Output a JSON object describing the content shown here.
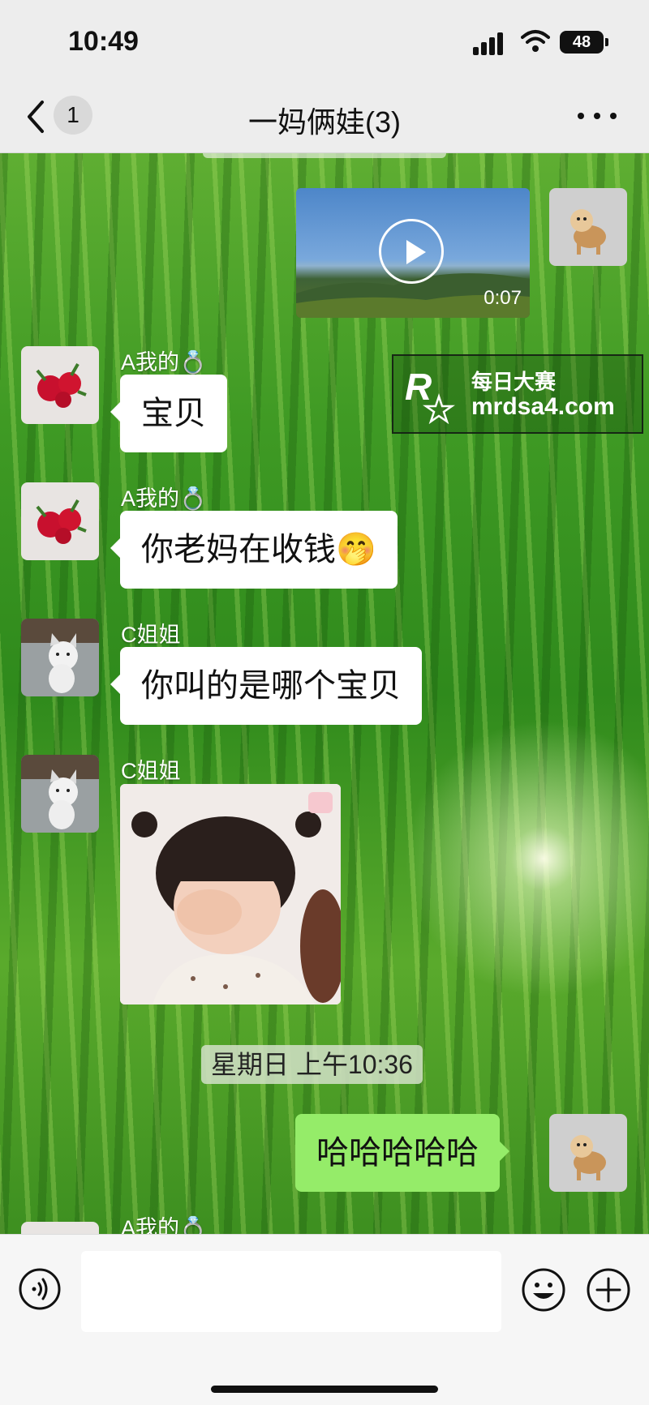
{
  "status_bar": {
    "time": "10:49",
    "battery": "48"
  },
  "nav": {
    "unread_count": "1",
    "title": "一妈俩娃(3)"
  },
  "messages": [
    {
      "type": "video",
      "sender": "me",
      "duration": "0:07"
    },
    {
      "type": "text",
      "sender_name": "A我的💍",
      "text": "宝贝"
    },
    {
      "type": "text",
      "sender_name": "A我的💍",
      "text": "你老妈在收钱🤭"
    },
    {
      "type": "text",
      "sender_name": "C姐姐",
      "text": "你叫的是哪个宝贝"
    },
    {
      "type": "image",
      "sender_name": "C姐姐"
    },
    {
      "type": "timestamp",
      "text": "星期日 上午10:36"
    },
    {
      "type": "text",
      "sender": "me",
      "text": "哈哈哈哈哈"
    },
    {
      "type": "partial",
      "sender_name": "A我的💍"
    }
  ],
  "watermark": {
    "line1": "每日大赛",
    "line2": "mrdsa4.com"
  },
  "input": {
    "placeholder": ""
  },
  "icons": {
    "back": "chevron-left-icon",
    "more": "more-icon",
    "voice": "voice-icon",
    "emoji": "emoji-icon",
    "plus": "plus-icon"
  },
  "colors": {
    "my_bubble": "#95ec69",
    "their_bubble": "#ffffff",
    "header_bg": "#ededed"
  }
}
